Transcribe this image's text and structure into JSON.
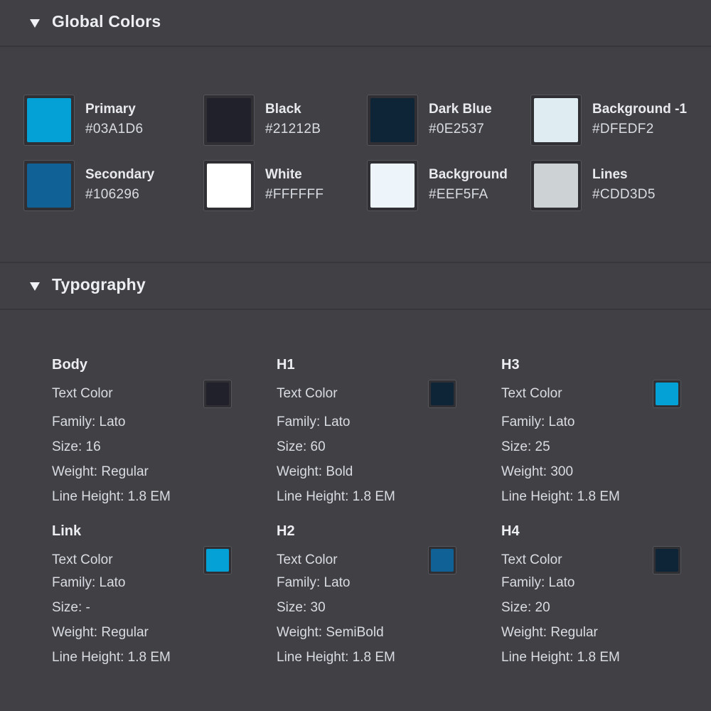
{
  "global_colors": {
    "title": "Global Colors",
    "items": [
      {
        "name": "Primary",
        "hex": "#03A1D6"
      },
      {
        "name": "Black",
        "hex": "#21212B"
      },
      {
        "name": "Dark Blue",
        "hex": "#0E2537"
      },
      {
        "name": "Background -1",
        "hex": "#DFEDF2"
      },
      {
        "name": "Secondary",
        "hex": "#106296"
      },
      {
        "name": "White",
        "hex": "#FFFFFF"
      },
      {
        "name": "Background",
        "hex": "#EEF5FA"
      },
      {
        "name": "Lines",
        "hex": "#CDD3D5"
      }
    ]
  },
  "typography": {
    "title": "Typography",
    "text_color_label": "Text Color",
    "styles": [
      {
        "name": "Body",
        "color": "#21212B",
        "family": "Family: Lato",
        "size": "Size: 16",
        "weight": "Weight: Regular",
        "line_height": "Line Height: 1.8 EM"
      },
      {
        "name": "H1",
        "color": "#0E2537",
        "family": "Family: Lato",
        "size": "Size: 60",
        "weight": "Weight: Bold",
        "line_height": "Line Height: 1.8 EM"
      },
      {
        "name": "H3",
        "color": "#03A1D6",
        "family": "Family: Lato",
        "size": "Size: 25",
        "weight": "Weight: 300",
        "line_height": "Line Height: 1.8 EM"
      },
      {
        "name": "Link",
        "color": "#03A1D6",
        "family": "Family: Lato",
        "size": "Size: -",
        "weight": "Weight: Regular",
        "line_height": "Line Height: 1.8 EM"
      },
      {
        "name": "H2",
        "color": "#106296",
        "family": "Family: Lato",
        "size": "Size: 30",
        "weight": "Weight: SemiBold",
        "line_height": "Line Height: 1.8 EM"
      },
      {
        "name": "H4",
        "color": "#0E2537",
        "family": "Family: Lato",
        "size": "Size: 20",
        "weight": "Weight: Regular",
        "line_height": "Line Height: 1.8 EM"
      }
    ]
  }
}
